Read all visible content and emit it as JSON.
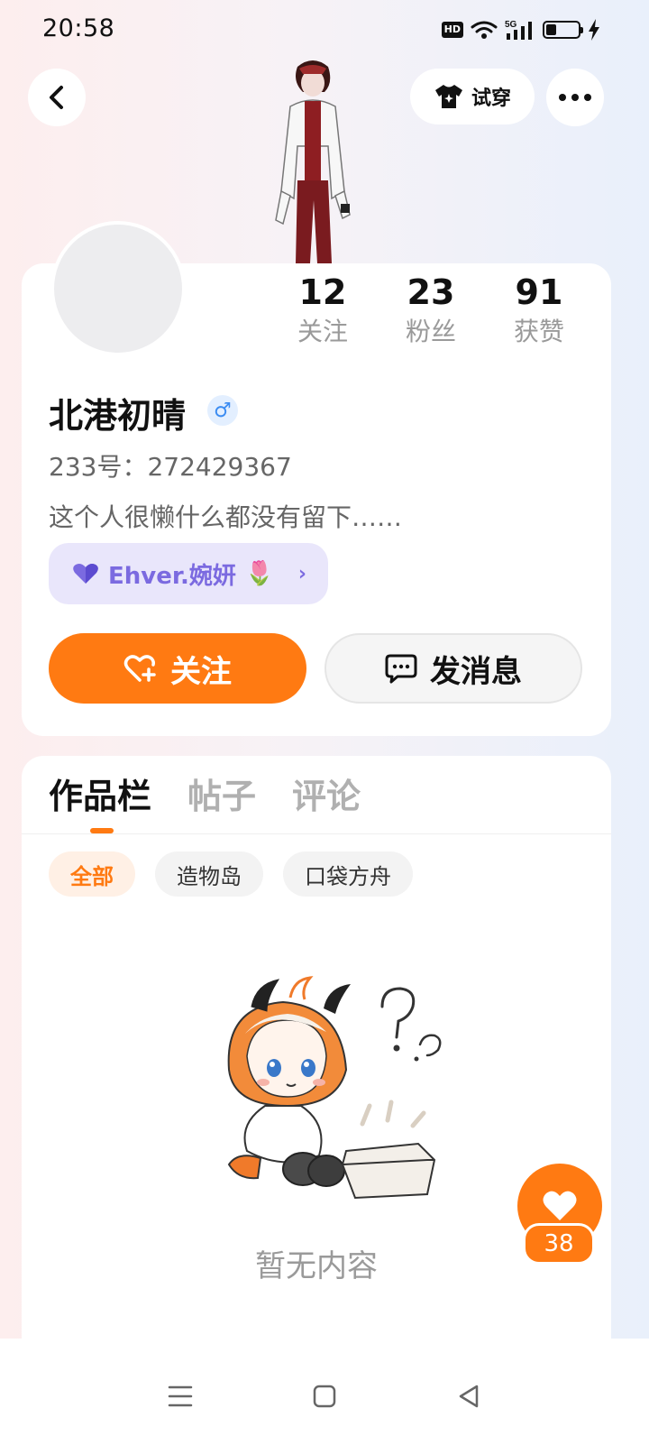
{
  "status_bar": {
    "time": "20:58",
    "hd": "HD",
    "network": "5G",
    "battery_level": 0.3
  },
  "header": {
    "tryon_label": "试穿"
  },
  "profile": {
    "name": "北港初晴",
    "gender_symbol": "♂",
    "id_text": "233号：272429367",
    "bio": "这个人很懒什么都没有留下……",
    "tag_label": "Ehver.婉妍",
    "tag_emoji": "🌷",
    "stats": [
      {
        "value": "12",
        "label": "关注"
      },
      {
        "value": "23",
        "label": "粉丝"
      },
      {
        "value": "91",
        "label": "获赞"
      }
    ],
    "follow_label": "关注",
    "message_label": "发消息"
  },
  "content": {
    "tabs": [
      {
        "label": "作品栏",
        "active": true
      },
      {
        "label": "帖子",
        "active": false
      },
      {
        "label": "评论",
        "active": false
      }
    ],
    "filters": [
      {
        "label": "全部",
        "active": true
      },
      {
        "label": "造物岛",
        "active": false
      },
      {
        "label": "口袋方舟",
        "active": false
      }
    ],
    "empty_text": "暂无内容"
  },
  "like_fab": {
    "count": "38"
  },
  "colors": {
    "accent": "#ff7a12",
    "tag_bg": "#e9e6fb",
    "tag_text": "#7b6ae0",
    "male_blue": "#3b8cf2"
  }
}
